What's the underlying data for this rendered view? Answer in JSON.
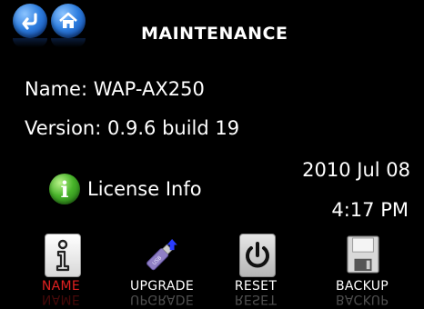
{
  "header": {
    "title": "MAINTENANCE"
  },
  "nav": {
    "back_icon": "back-arrow-icon",
    "home_icon": "home-icon"
  },
  "device": {
    "name_line": "Name: WAP-AX250",
    "version_line": "Version: 0.9.6 build 19"
  },
  "license": {
    "label": "License Info",
    "icon": "info-icon"
  },
  "clock": {
    "date": "2010 Jul 08",
    "time": "4:17 PM"
  },
  "toolbar": {
    "items": [
      {
        "label": "NAME",
        "icon": "name-info-icon",
        "active": true
      },
      {
        "label": "UPGRADE",
        "icon": "usb-drive-icon",
        "active": false
      },
      {
        "label": "RESET",
        "icon": "power-icon",
        "active": false
      },
      {
        "label": "BACKUP",
        "icon": "floppy-disk-icon",
        "active": false
      }
    ]
  },
  "colors": {
    "active_label": "#e02020",
    "accent_blue": "#2f7fe0",
    "info_green": "#48b42a"
  }
}
